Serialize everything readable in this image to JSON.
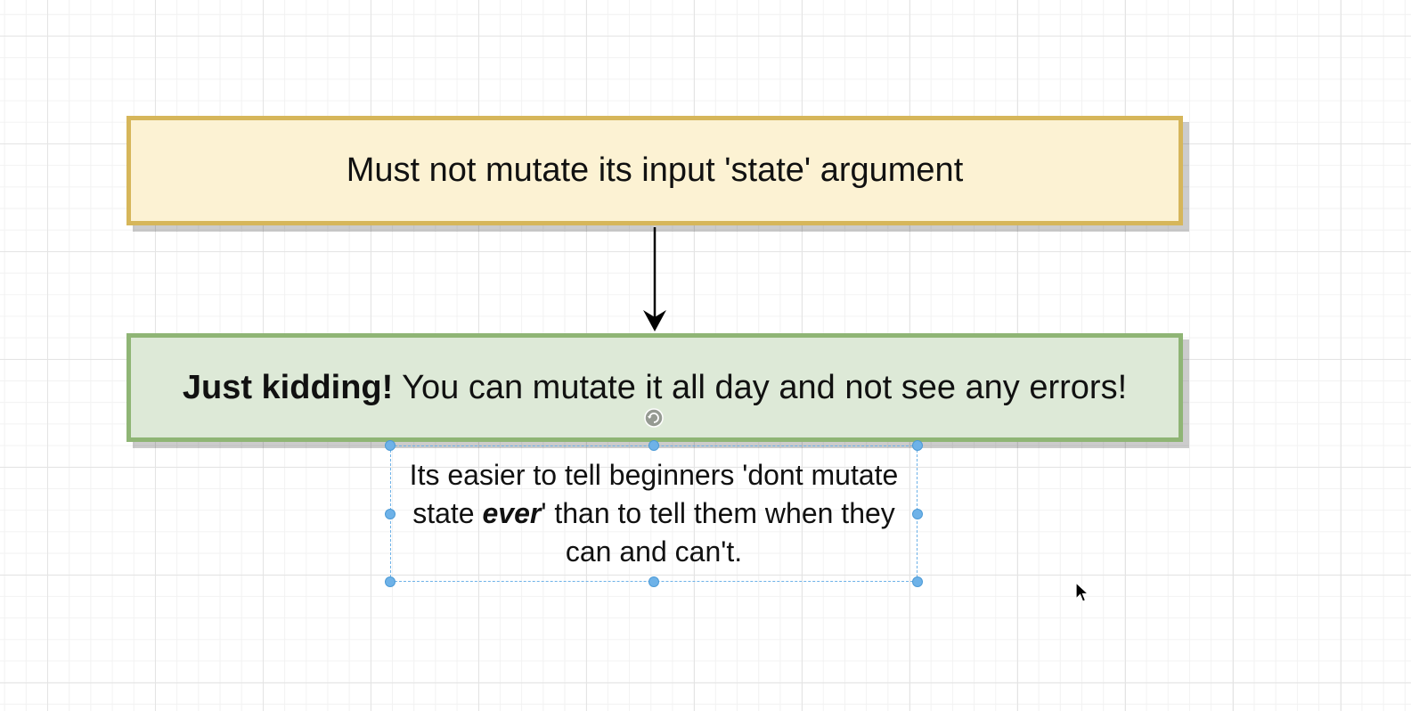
{
  "diagram": {
    "top_box": {
      "text": "Must not mutate its input 'state' argument",
      "fill": "#fcf2d3",
      "stroke": "#d6b65a"
    },
    "bottom_box": {
      "bold_text": "Just kidding!",
      "text": " You can mutate it all day and not see any errors!",
      "fill": "#dde9d7",
      "stroke": "#8fb575"
    },
    "note": {
      "text_before": "Its easier to tell beginners 'dont mutate state ",
      "emphasis": "ever",
      "text_after": "' than to tell them when they can and can't.",
      "selection_color": "#6eb2e8"
    },
    "connector": {
      "from": "top_box",
      "to": "bottom_box",
      "arrow": "arrow-down-icon"
    }
  }
}
